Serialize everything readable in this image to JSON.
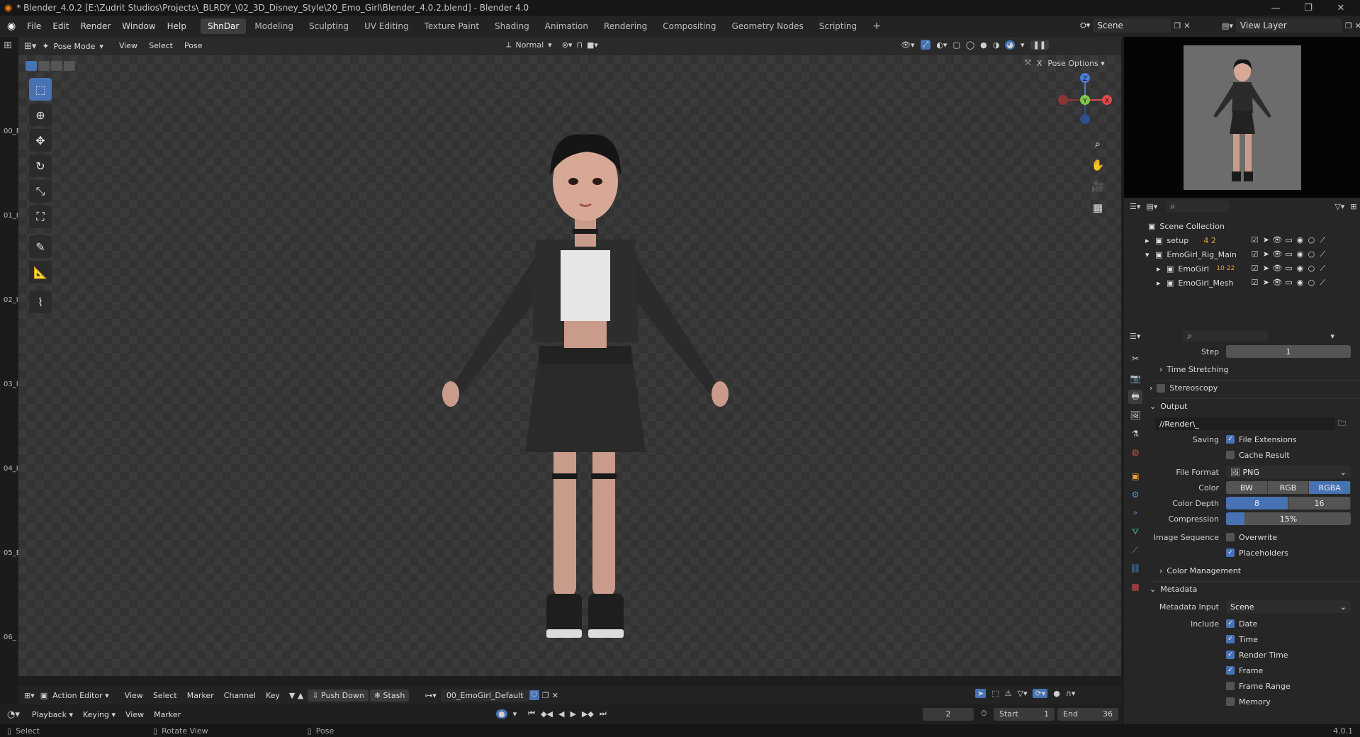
{
  "window": {
    "title": "* Blender_4.0.2 [E:\\Zudrit Studios\\Projects\\_BLRDY_\\02_3D_Disney_Style\\20_Emo_Girl\\Blender_4.0.2.blend] - Blender 4.0"
  },
  "menu": {
    "items": [
      "File",
      "Edit",
      "Render",
      "Window",
      "Help"
    ]
  },
  "workspaces": [
    "ShnDar",
    "Modeling",
    "Sculpting",
    "UV Editing",
    "Texture Paint",
    "Shading",
    "Animation",
    "Rendering",
    "Compositing",
    "Geometry Nodes",
    "Scripting"
  ],
  "active_workspace": "ShnDar",
  "scene_name": "Scene",
  "view_layer": "View Layer",
  "viewport": {
    "mode": "Pose Mode",
    "menus": [
      "View",
      "Select",
      "Pose"
    ],
    "orientation": "Normal",
    "pose_options": "Pose Options"
  },
  "left_strip_labels": [
    "00_E",
    "01_I",
    "02_I",
    "03_I",
    "04_I",
    "05_E",
    "06_"
  ],
  "gizmo": {
    "x": "X",
    "y": "Y",
    "z": "Z"
  },
  "outliner": {
    "root": "Scene Collection",
    "items": [
      {
        "name": "setup",
        "badge": "4 2"
      },
      {
        "name": "EmoGirl_Rig_Main",
        "badge": ""
      },
      {
        "name": "EmoGirl",
        "badge": "10 22"
      },
      {
        "name": "EmoGirl_Mesh",
        "badge": ""
      }
    ]
  },
  "props": {
    "step_label": "Step",
    "step_value": "1",
    "time_stretching": "Time Stretching",
    "stereoscopy": "Stereoscopy",
    "output": "Output",
    "output_path": "//Render\\_",
    "saving_label": "Saving",
    "file_extensions": "File Extensions",
    "cache_result": "Cache Result",
    "file_format_label": "File Format",
    "file_format": "PNG",
    "color_label": "Color",
    "color_options": [
      "BW",
      "RGB",
      "RGBA"
    ],
    "color_selected": "RGBA",
    "color_depth_label": "Color Depth",
    "color_depth_options": [
      "8",
      "16"
    ],
    "color_depth_selected": "8",
    "compression_label": "Compression",
    "compression_value": "15%",
    "compression_fraction": 0.15,
    "image_sequence_label": "Image Sequence",
    "overwrite": "Overwrite",
    "placeholders": "Placeholders",
    "color_management": "Color Management",
    "metadata": "Metadata",
    "metadata_input_label": "Metadata Input",
    "metadata_input": "Scene",
    "include_label": "Include",
    "include_items": [
      {
        "label": "Date",
        "on": true
      },
      {
        "label": "Time",
        "on": true
      },
      {
        "label": "Render Time",
        "on": true
      },
      {
        "label": "Frame",
        "on": true
      },
      {
        "label": "Frame Range",
        "on": false
      },
      {
        "label": "Memory",
        "on": false
      }
    ]
  },
  "timeline": {
    "editor": "Action Editor",
    "menus": [
      "View",
      "Select",
      "Marker",
      "Channel",
      "Key"
    ],
    "push_down": "Push Down",
    "stash": "Stash",
    "action": "00_EmoGirl_Default",
    "playback": "Playback",
    "keying": "Keying",
    "view": "View",
    "marker": "Marker",
    "current_frame": "2",
    "start_label": "Start",
    "start": "1",
    "end_label": "End",
    "end": "36"
  },
  "status": {
    "select": "Select",
    "rotate": "Rotate View",
    "pose": "Pose",
    "version": "4.0.1"
  }
}
